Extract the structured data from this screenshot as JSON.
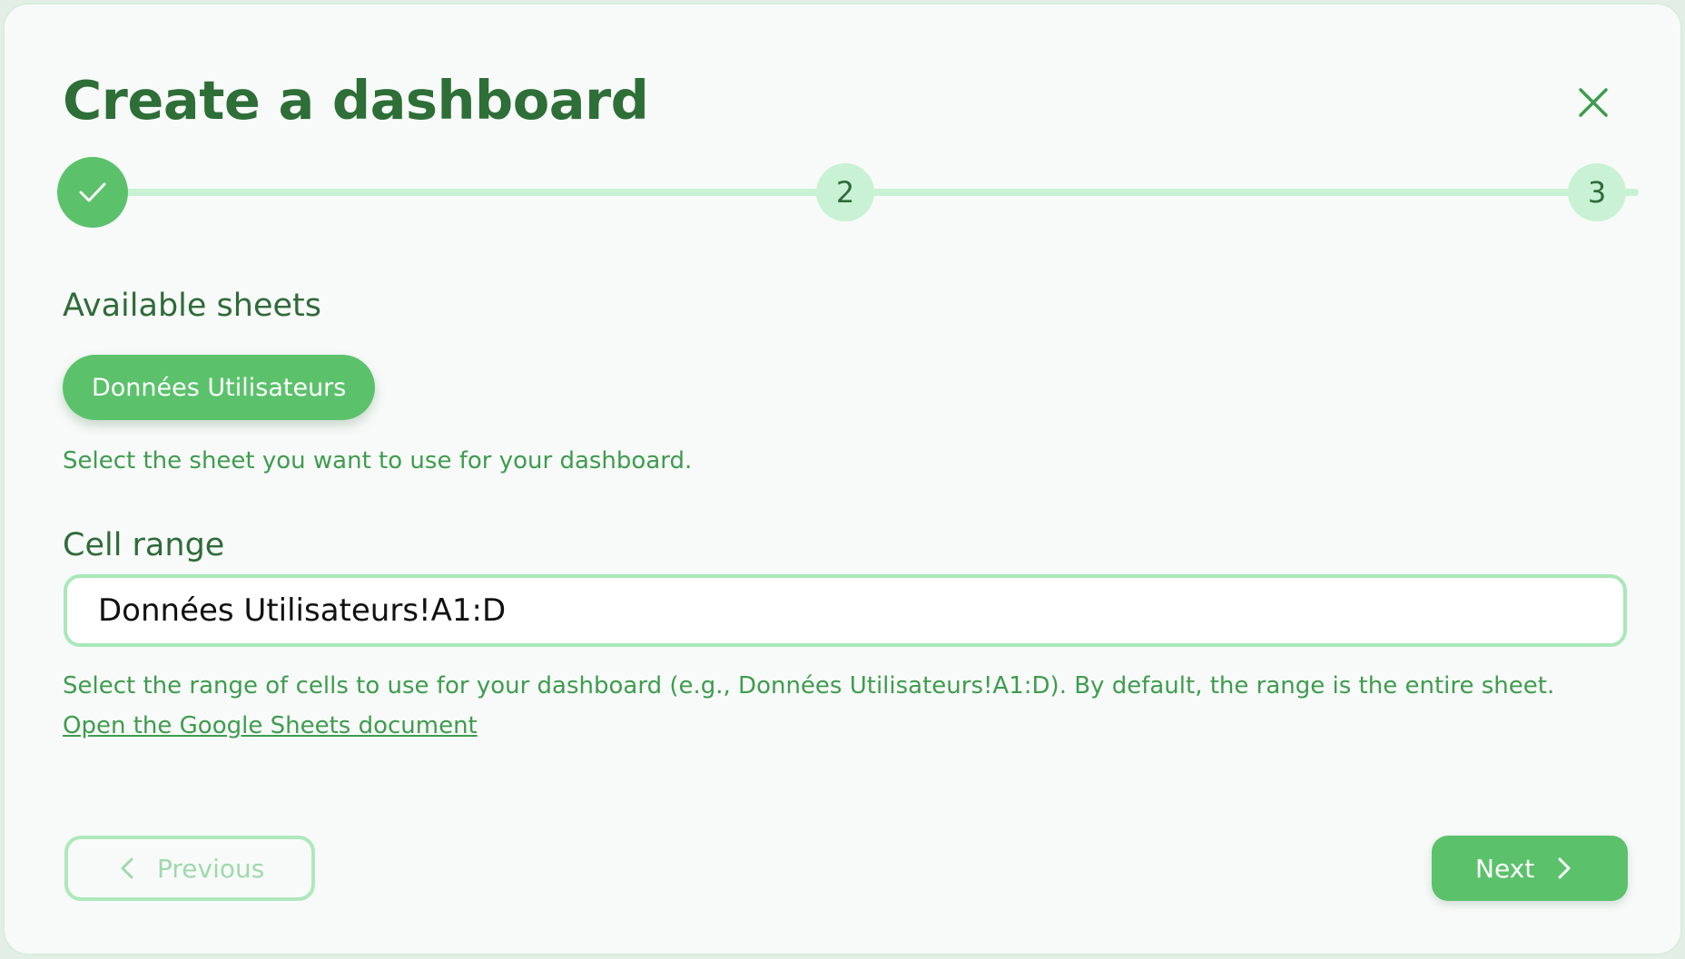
{
  "dialog": {
    "title": "Create a dashboard",
    "close_icon": "close-icon"
  },
  "stepper": {
    "steps": [
      {
        "label": "",
        "status": "completed",
        "icon": "check-icon"
      },
      {
        "label": "2",
        "status": "pending"
      },
      {
        "label": "3",
        "status": "pending"
      }
    ]
  },
  "sheets": {
    "label": "Available sheets",
    "items": [
      "Données Utilisateurs"
    ],
    "selected": "Données Utilisateurs",
    "help": "Select the sheet you want to use for your dashboard."
  },
  "range": {
    "label": "Cell range",
    "value": "Données Utilisateurs!A1:D",
    "help": "Select the range of cells to use for your dashboard (e.g., Données Utilisateurs!A1:D). By default, the range is the entire sheet.",
    "link": "Open the Google Sheets document"
  },
  "footer": {
    "previous_label": "Previous",
    "previous_icon": "chevron-left-icon",
    "next_label": "Next",
    "next_icon": "chevron-right-icon"
  },
  "colors": {
    "primary": "#5bc26b",
    "primary_light": "#c8f2d3",
    "title": "#2e6e37",
    "help_text": "#3e9c4e",
    "background": "#f8faf9"
  }
}
